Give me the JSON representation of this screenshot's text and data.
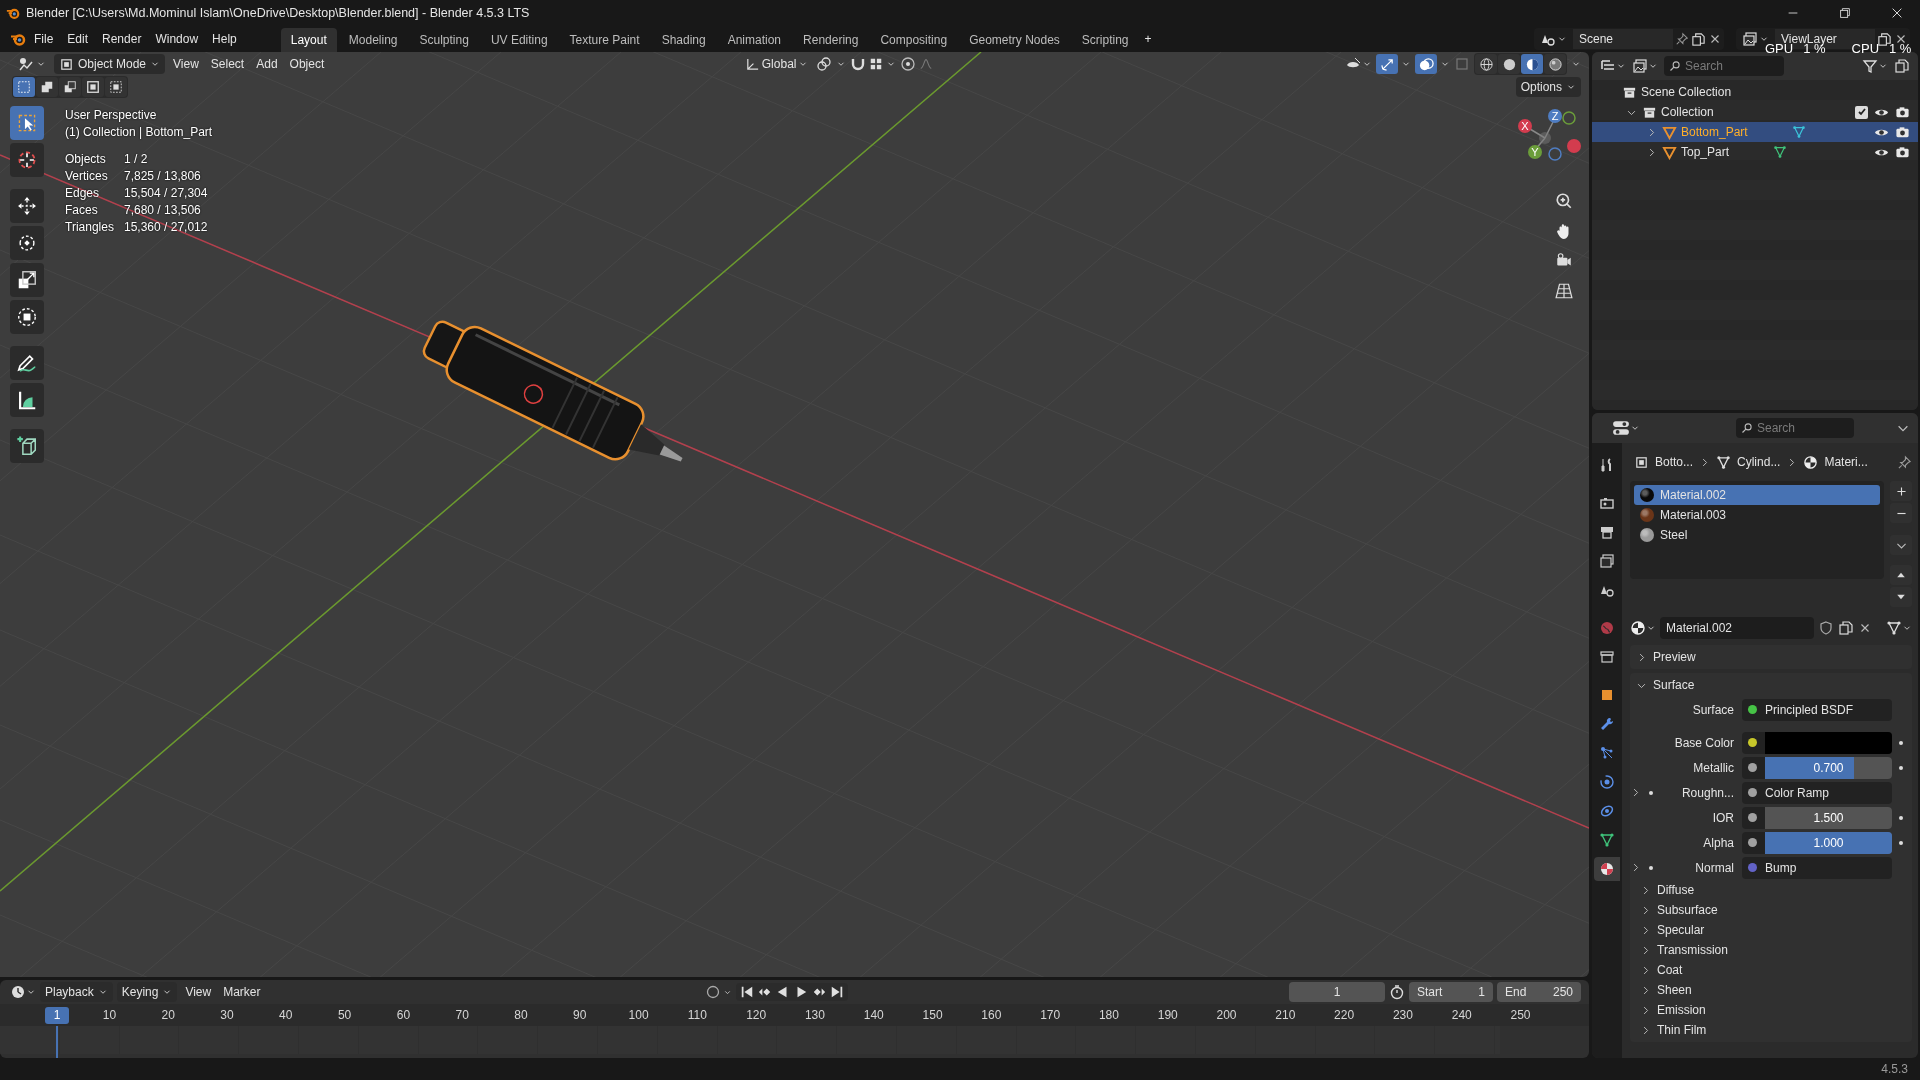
{
  "title_bar": {
    "title": "Blender [C:\\Users\\Md.Mominul Islam\\OneDrive\\Desktop\\Blender.blend] - Blender 4.5.3 LTS"
  },
  "menu": [
    "File",
    "Edit",
    "Render",
    "Window",
    "Help"
  ],
  "workspaces": [
    {
      "label": "Layout",
      "selected": true
    },
    {
      "label": "Modeling",
      "selected": false
    },
    {
      "label": "Sculpting",
      "selected": false
    },
    {
      "label": "UV Editing",
      "selected": false
    },
    {
      "label": "Texture Paint",
      "selected": false
    },
    {
      "label": "Shading",
      "selected": false
    },
    {
      "label": "Animation",
      "selected": false
    },
    {
      "label": "Rendering",
      "selected": false
    },
    {
      "label": "Compositing",
      "selected": false
    },
    {
      "label": "Geometry Nodes",
      "selected": false
    },
    {
      "label": "Scripting",
      "selected": false
    }
  ],
  "add_workspace": "+",
  "scene": {
    "name": "Scene"
  },
  "view_layer": {
    "name": "ViewLayer"
  },
  "performance": [
    {
      "label": "GPU",
      "value": "1 %"
    },
    {
      "label": "CPU",
      "value": "1 %"
    }
  ],
  "viewport": {
    "mode": "Object Mode",
    "menus": [
      "View",
      "Select",
      "Add",
      "Object"
    ],
    "orientation": "Global",
    "options": "Options",
    "gizmos_on": true,
    "overlays_on": true,
    "shading": [
      {
        "kind": "wireframe",
        "selected": false
      },
      {
        "kind": "solid",
        "selected": false
      },
      {
        "kind": "material",
        "selected": true
      },
      {
        "kind": "rendered",
        "selected": false
      }
    ],
    "view_name": "User Perspective",
    "context": "(1) Collection | Bottom_Part",
    "stats": [
      {
        "label": "Objects",
        "value": "1 / 2"
      },
      {
        "label": "Vertices",
        "value": "7,825 / 13,806"
      },
      {
        "label": "Edges",
        "value": "15,504 / 27,304"
      },
      {
        "label": "Faces",
        "value": "7,680 / 13,506"
      },
      {
        "label": "Triangles",
        "value": "15,360 / 27,012"
      }
    ],
    "gizmo_axes": [
      "X",
      "Y",
      "Z"
    ],
    "tools": [
      {
        "kind": "select",
        "selected": true
      },
      {
        "kind": "cursor",
        "selected": false
      },
      {
        "kind": "move",
        "selected": false
      },
      {
        "kind": "rotate",
        "selected": false
      },
      {
        "kind": "scale",
        "selected": false
      },
      {
        "kind": "transform",
        "selected": false
      },
      {
        "kind": "annotate",
        "selected": false
      },
      {
        "kind": "measure",
        "selected": false
      },
      {
        "kind": "add_cube",
        "selected": false
      }
    ]
  },
  "outliner": {
    "search_placeholder": "Search",
    "tree": [
      {
        "label": "Scene Collection",
        "kind": "scene",
        "children": [
          {
            "label": "Collection",
            "kind": "collection",
            "expanded": true,
            "checked": true,
            "children": [
              {
                "label": "Bottom_Part",
                "kind": "object",
                "expanded": false,
                "selected": true
              },
              {
                "label": "Top_Part",
                "kind": "object",
                "expanded": false,
                "selected": false
              }
            ]
          }
        ]
      }
    ]
  },
  "properties": {
    "search_placeholder": "Search",
    "tabs": [
      {
        "kind": "tool",
        "selected": false
      },
      {
        "kind": "render",
        "selected": false
      },
      {
        "kind": "output",
        "selected": false
      },
      {
        "kind": "view_layer",
        "selected": false
      },
      {
        "kind": "scene",
        "selected": false
      },
      {
        "kind": "world",
        "selected": false
      },
      {
        "kind": "collection",
        "selected": false
      },
      {
        "kind": "object",
        "selected": false
      },
      {
        "kind": "modifiers",
        "selected": false
      },
      {
        "kind": "particles",
        "selected": false
      },
      {
        "kind": "physics",
        "selected": false
      },
      {
        "kind": "constraints",
        "selected": false
      },
      {
        "kind": "data",
        "selected": false
      },
      {
        "kind": "material",
        "selected": true
      }
    ],
    "breadcrumb": [
      {
        "kind": "object",
        "label": "Botto..."
      },
      {
        "kind": "mesh",
        "label": "Cylind..."
      },
      {
        "kind": "material",
        "label": "Materi..."
      }
    ],
    "material_slots": [
      {
        "name": "Material.002",
        "color": "#0a0a0a",
        "selected": true
      },
      {
        "name": "Material.003",
        "color": "#6b3518",
        "selected": false
      },
      {
        "name": "Steel",
        "color": "#9a9a9a",
        "selected": false
      }
    ],
    "material": "Material.002",
    "panels": [
      {
        "title": "Preview",
        "expanded": false
      },
      {
        "title": "Surface",
        "expanded": true,
        "rows": [
          {
            "kind": "link",
            "label": "Surface",
            "color": "#46c346",
            "value": "Principled BSDF",
            "expandable": false
          },
          {
            "kind": "swatch",
            "label": "Base Color",
            "color": "#c7c72a",
            "expandable": false
          },
          {
            "kind": "slider",
            "label": "Metallic",
            "color": "#a1a1a1",
            "value": "0.700",
            "level": 0.7,
            "expandable": false
          },
          {
            "kind": "link",
            "label": "Roughn...",
            "color": "#a1a1a1",
            "value": "Color Ramp",
            "expandable": true
          },
          {
            "kind": "number",
            "label": "IOR",
            "color": "#a1a1a1",
            "value": "1.500",
            "expandable": false
          },
          {
            "kind": "slider",
            "label": "Alpha",
            "color": "#a1a1a1",
            "value": "1.000",
            "level": 1,
            "expandable": false
          },
          {
            "kind": "link",
            "label": "Normal",
            "color": "#6363c7",
            "value": "Bump",
            "expandable": true
          }
        ],
        "subpanels": [
          "Diffuse",
          "Subsurface",
          "Specular",
          "Transmission",
          "Coat",
          "Sheen",
          "Emission",
          "Thin Film"
        ]
      }
    ]
  },
  "timeline": {
    "menus": [
      "Playback",
      "Keying",
      "View",
      "Marker"
    ],
    "current_frame": "1",
    "start_label": "Start",
    "start": "1",
    "end_label": "End",
    "end": "250",
    "ruler_current": "1",
    "ruler_labels": [
      "10",
      "20",
      "30",
      "40",
      "50",
      "60",
      "70",
      "80",
      "90",
      "100",
      "110",
      "120",
      "130",
      "140",
      "150",
      "160",
      "170",
      "180",
      "190",
      "200",
      "210",
      "220",
      "230",
      "240",
      "250"
    ]
  },
  "status_bar": {
    "version": "4.5.3"
  }
}
